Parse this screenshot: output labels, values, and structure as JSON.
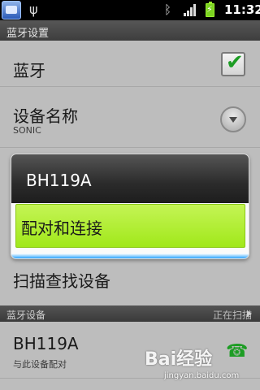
{
  "status_bar": {
    "app_icon": "notification-app-icon",
    "usb_icon": "usb-icon",
    "bluetooth_icon": "bluetooth-icon",
    "signal_icon": "signal-icon",
    "battery_icon": "battery-charging-icon",
    "time": "11:32"
  },
  "title_bar": {
    "title": "蓝牙设置"
  },
  "settings": {
    "bluetooth": {
      "label": "蓝牙",
      "checked": true
    },
    "device_name": {
      "label": "设备名称",
      "value": "SONIC"
    },
    "scan": {
      "label": "扫描查找设备"
    }
  },
  "context_menu": {
    "title": "BH119A",
    "items": [
      {
        "label": "配对和连接"
      }
    ]
  },
  "devices_section": {
    "title": "蓝牙设备",
    "status": "正在扫描"
  },
  "devices": [
    {
      "name": "BH119A",
      "status": "与此设备配对"
    }
  ],
  "watermark": {
    "logo": "Bai经验",
    "url": "jingyan.baidu.com"
  },
  "colors": {
    "accent_green": "#a1e81a",
    "check_green": "#1d9d24",
    "background": "#bdbdbd"
  }
}
